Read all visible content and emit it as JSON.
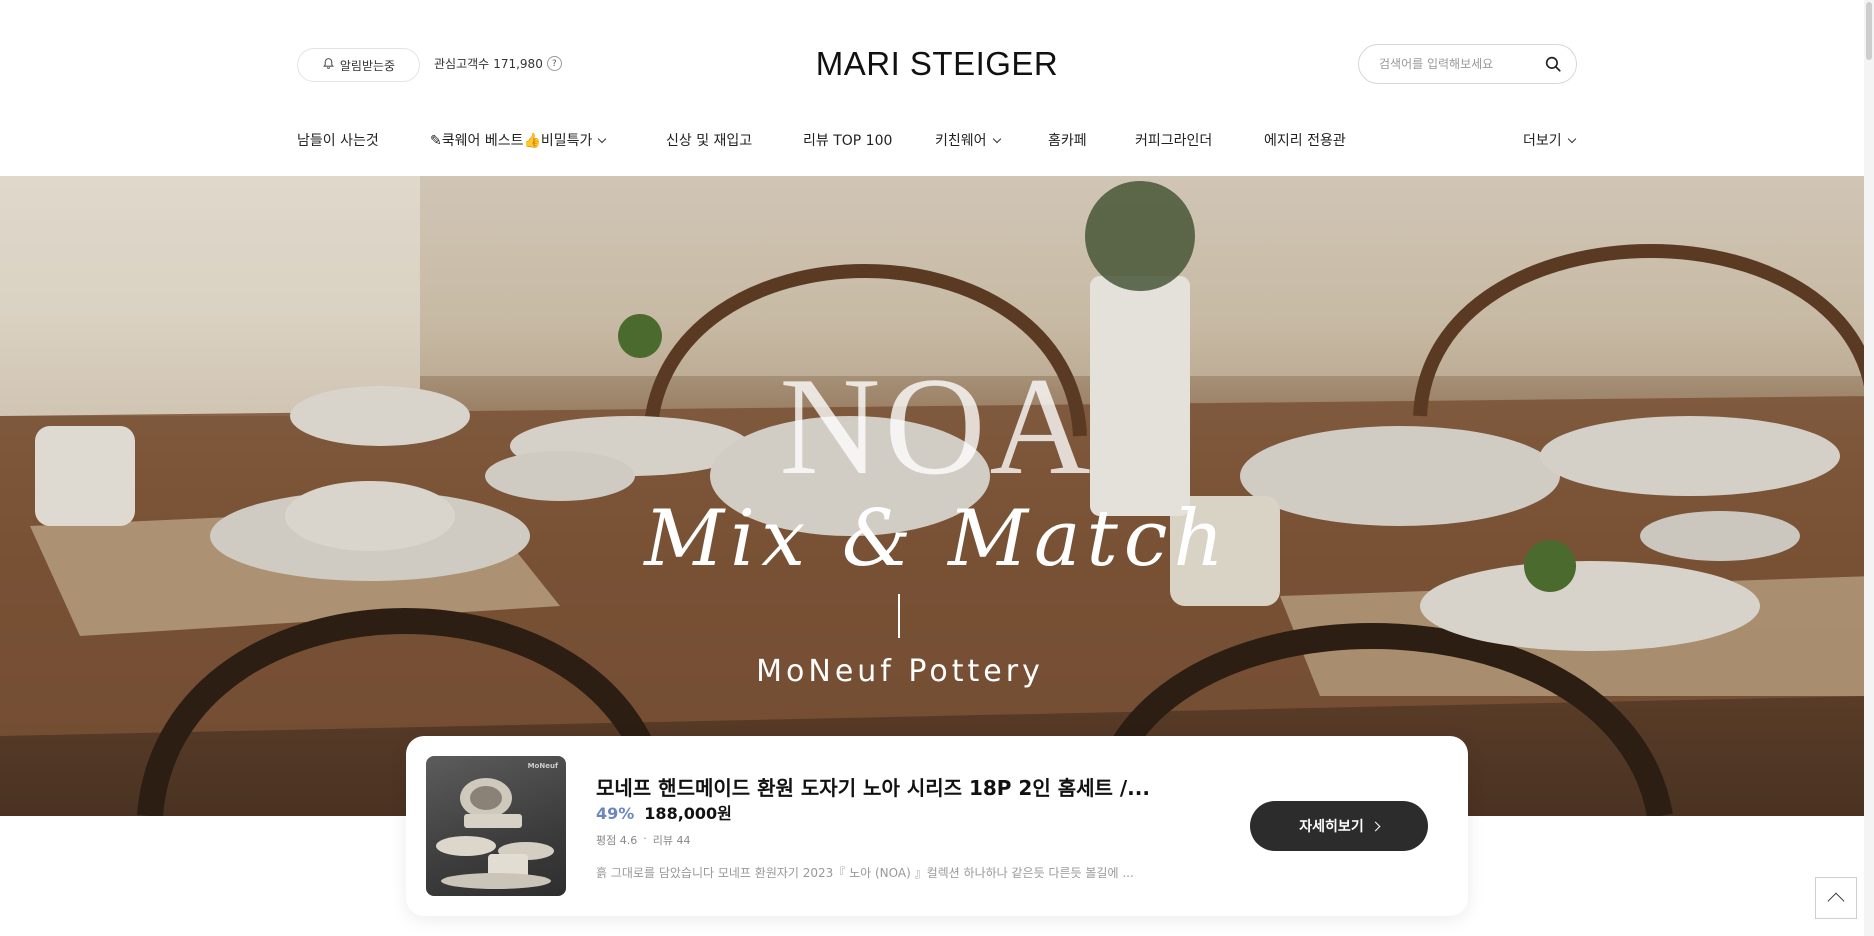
{
  "header": {
    "alarm_label": "알림받는중",
    "fans_label": "관심고객수",
    "fans_count": "171,980",
    "help_icon": "?",
    "logo": "MARI STEIGER",
    "search_placeholder": "검색어를 입력해보세요"
  },
  "nav": {
    "items": [
      {
        "label": "남들이 사는것"
      },
      {
        "label": "✎쿡웨어 베스트👍비밀특가"
      },
      {
        "label": "신상 및 재입고"
      },
      {
        "label": "리뷰 TOP 100"
      },
      {
        "label": "키친웨어"
      },
      {
        "label": "홈카페"
      },
      {
        "label": "커피그라인더"
      },
      {
        "label": "에지리 전용관"
      }
    ],
    "more_label": "더보기"
  },
  "hero": {
    "title": "NOA",
    "script": "Mix & Match",
    "subtitle": "MoNeuf Pottery"
  },
  "product": {
    "thumb_logo": "MoNeuf",
    "name": "모네프 핸드메이드 환원 도자기 노아 시리즈 18P 2인 홈세트 /...",
    "discount": "49%",
    "price": "188,000원",
    "rating": "평점 4.6",
    "reviews": "리뷰 44",
    "description": "흙 그대로를 담았습니다 모네프 환원자기 2023『 노아 (NOA) 』컬렉션 하나하나 같은듯 다른듯 볼길에 ...",
    "button_label": "자세히보기"
  },
  "colors": {
    "accent": "#6c86c1",
    "button_bg": "#2c2c2c"
  }
}
